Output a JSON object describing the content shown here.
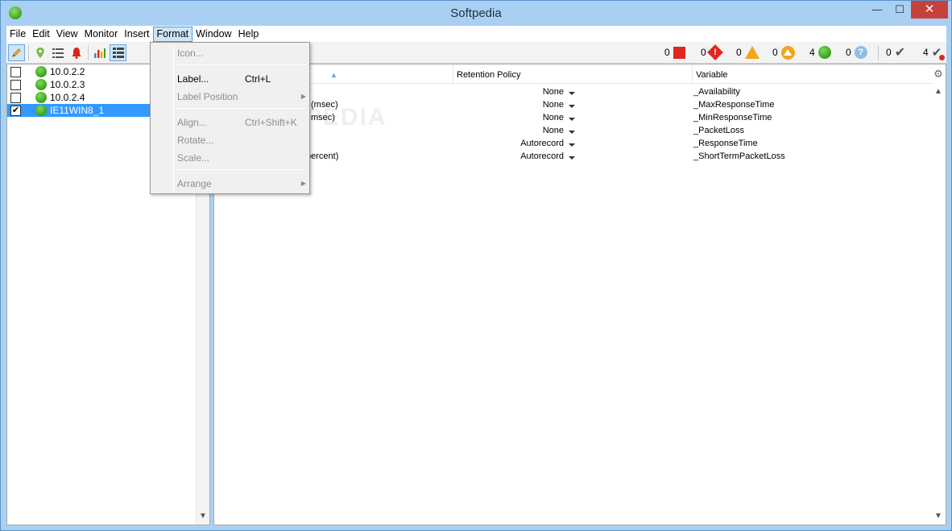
{
  "window": {
    "title": "Softpedia",
    "min_glyph": "—",
    "max_glyph": "☐",
    "close_glyph": "✕"
  },
  "menubar": {
    "items": [
      "File",
      "Edit",
      "View",
      "Monitor",
      "Insert",
      "Format",
      "Window",
      "Help"
    ],
    "active": "Format"
  },
  "toolbar": {
    "tools": [
      "pencil-icon",
      "map-pin-icon",
      "list-icon",
      "bell-icon",
      "bar-chart-icon",
      "grid-list-icon"
    ],
    "status": [
      {
        "count": "0",
        "icon": "red-square-icon"
      },
      {
        "count": "0",
        "icon": "red-diamond-icon"
      },
      {
        "count": "0",
        "icon": "orange-triangle-icon"
      },
      {
        "count": "0",
        "icon": "orange-circle-triangle-icon"
      },
      {
        "count": "4",
        "icon": "green-dot-icon"
      },
      {
        "count": "0",
        "icon": "question-icon"
      },
      {
        "count": "0",
        "icon": "check-icon"
      },
      {
        "count": "4",
        "icon": "check-alert-icon"
      }
    ]
  },
  "hosts": [
    {
      "name": "10.0.2.2",
      "checked": false,
      "selected": false
    },
    {
      "name": "10.0.2.3",
      "checked": false,
      "selected": false
    },
    {
      "name": "10.0.2.4",
      "checked": false,
      "selected": false
    },
    {
      "name": "IE11WIN8_1",
      "checked": true,
      "selected": true
    }
  ],
  "grid": {
    "columns": {
      "policy": "Retention Policy",
      "variable": "Variable"
    },
    "rows": [
      {
        "name": "",
        "policy": "None",
        "variable": "_Availability"
      },
      {
        "name": "(msec)",
        "policy": "None",
        "variable": "_MaxResponseTime"
      },
      {
        "name": "msec)",
        "policy": "None",
        "variable": "_MinResponseTime"
      },
      {
        "name": "",
        "policy": "None",
        "variable": "_PacketLoss"
      },
      {
        "name": "",
        "policy": "Autorecord",
        "variable": "_ResponseTime"
      },
      {
        "name": "percent)",
        "policy": "Autorecord",
        "variable": "_ShortTermPacketLoss"
      }
    ]
  },
  "format_menu": {
    "icon": "Icon...",
    "label": "Label...",
    "label_shortcut": "Ctrl+L",
    "label_position": "Label Position",
    "align": "Align...",
    "align_shortcut": "Ctrl+Shift+K",
    "rotate": "Rotate...",
    "scale": "Scale...",
    "arrange": "Arrange"
  },
  "watermark": "SOFTPEDIA"
}
